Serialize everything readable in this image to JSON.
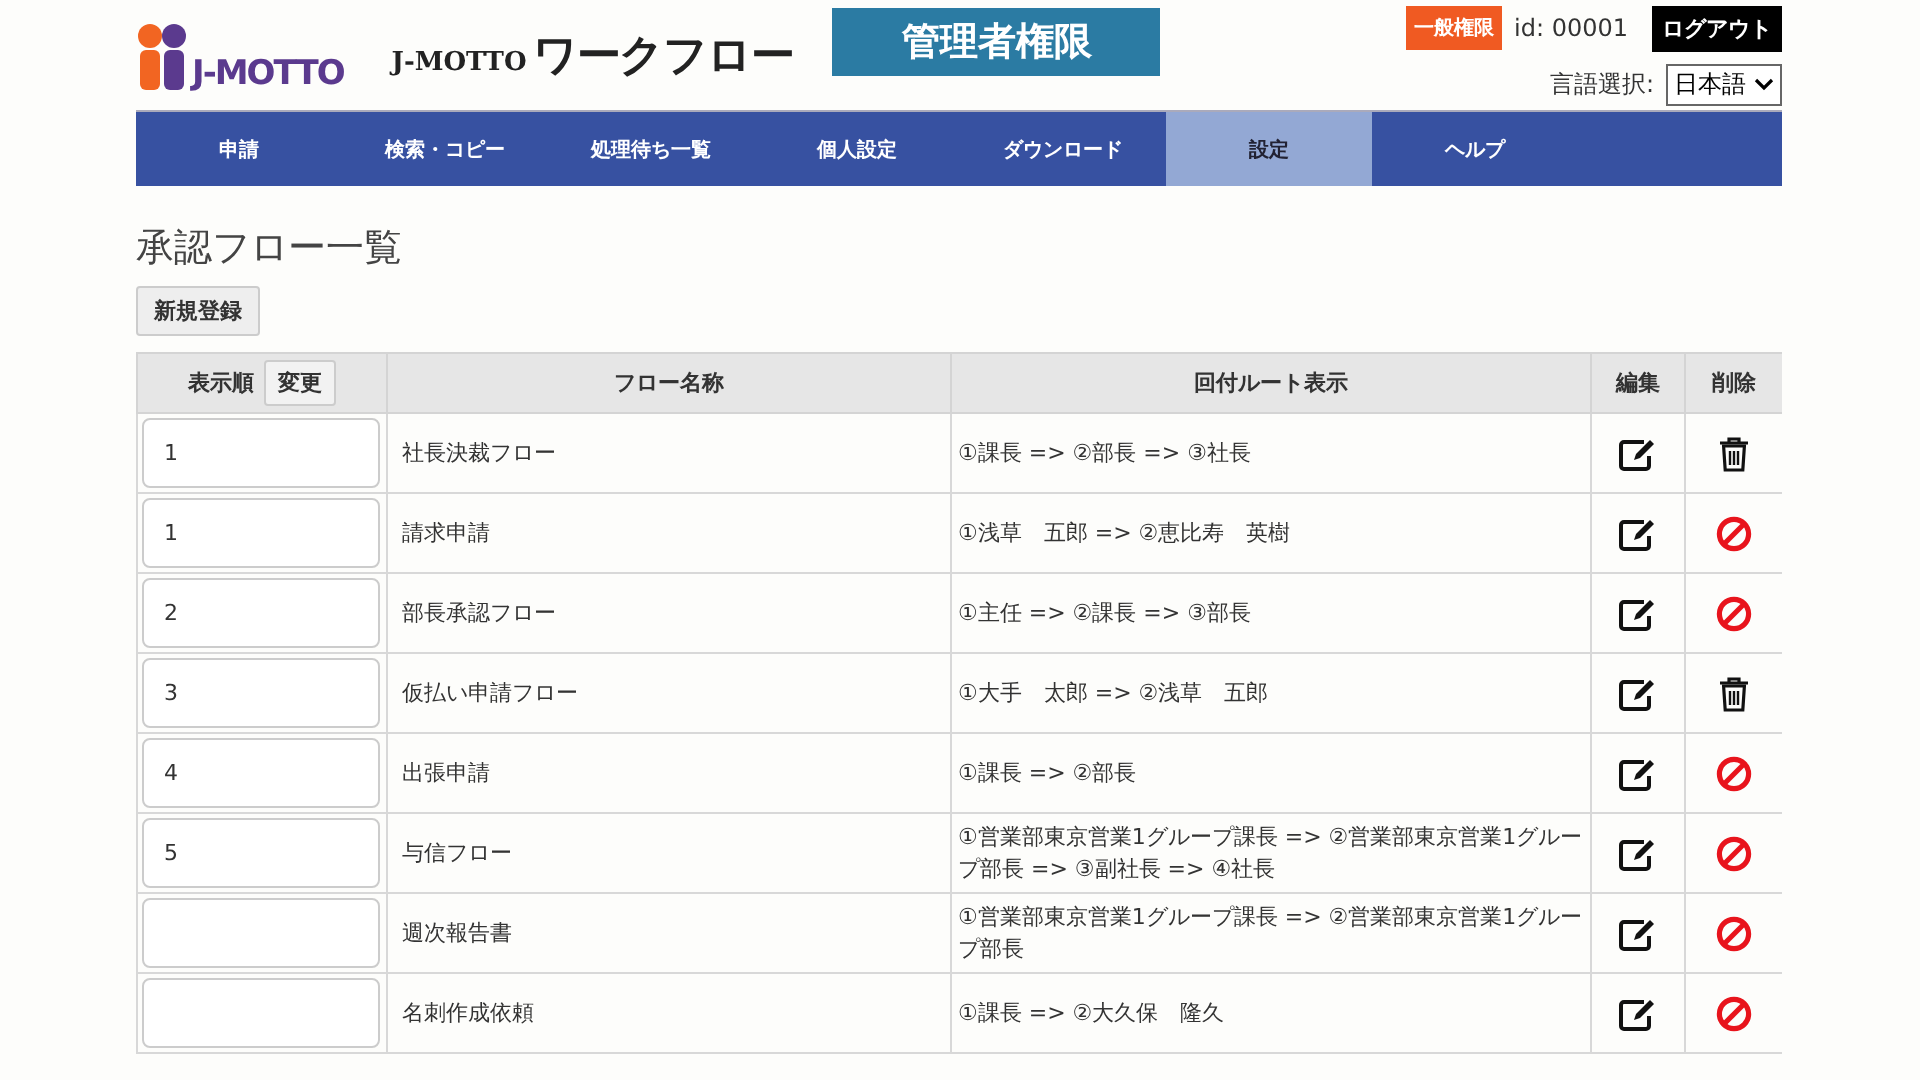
{
  "header": {
    "logo_text": "J-MOTTO",
    "app_brand": "J-MOTTO",
    "app_title": "ワークフロー",
    "admin_badge": "管理者権限",
    "role_badge": "一般権限",
    "user_id": "id: 00001",
    "logout": "ログアウト",
    "language_label": "言語選択:",
    "language": "日本語"
  },
  "nav": [
    {
      "label": "申請",
      "selected": false
    },
    {
      "label": "検索・コピー",
      "selected": false
    },
    {
      "label": "処理待ち一覧",
      "selected": false
    },
    {
      "label": "個人設定",
      "selected": false
    },
    {
      "label": "ダウンロード",
      "selected": false
    },
    {
      "label": "設定",
      "selected": true
    },
    {
      "label": "ヘルプ",
      "selected": false
    }
  ],
  "page_title": "承認フロー一覧",
  "new_button": "新規登録",
  "table": {
    "columns": [
      "表示順",
      "フロー名称",
      "回付ルート表示",
      "編集",
      "削除"
    ],
    "order_button": "変更",
    "rows": [
      {
        "order": "1",
        "name": "社長決裁フロー",
        "route": "①課長 => ②部長 => ③社長",
        "deletable": true
      },
      {
        "order": "1",
        "name": "請求申請",
        "route": "①浅草　五郎 => ②恵比寿　英樹",
        "deletable": false
      },
      {
        "order": "2",
        "name": "部長承認フロー",
        "route": "①主任 => ②課長 => ③部長",
        "deletable": false
      },
      {
        "order": "3",
        "name": "仮払い申請フロー",
        "route": "①大手　太郎 => ②浅草　五郎",
        "deletable": true
      },
      {
        "order": "4",
        "name": "出張申請",
        "route": "①課長 => ②部長",
        "deletable": false
      },
      {
        "order": "5",
        "name": "与信フロー",
        "route": "①営業部東京営業1グループ課長 => ②営業部東京営業1グループ部長 => ③副社長 => ④社長",
        "deletable": false
      },
      {
        "name": "週次報告書",
        "route": "①営業部東京営業1グループ課長 => ②営業部東京営業1グループ部長",
        "deletable": false
      },
      {
        "name": "名刺作成依頼",
        "route": "①課長 => ②大久保　隆久",
        "deletable": false
      }
    ]
  }
}
